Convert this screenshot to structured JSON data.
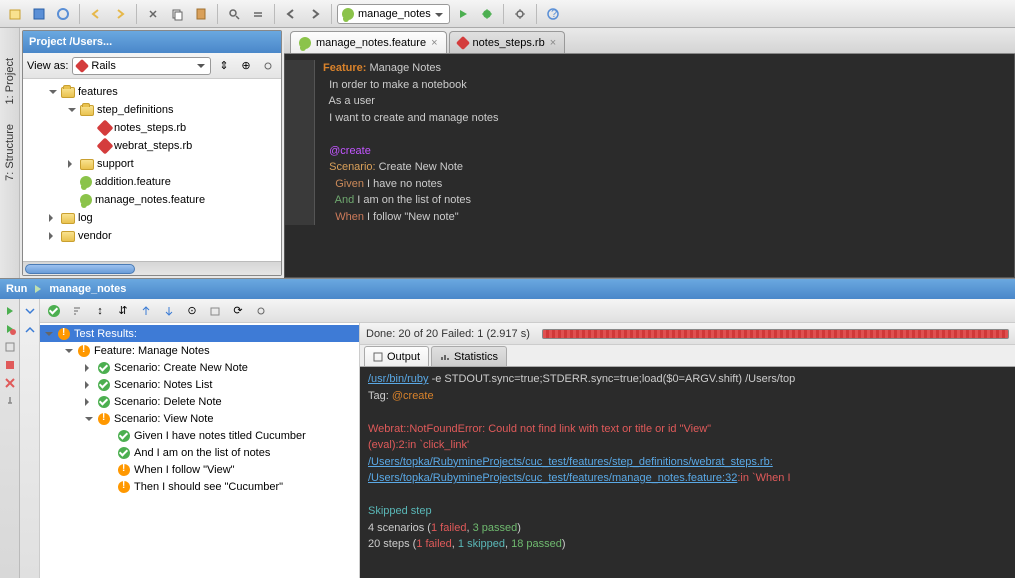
{
  "toolbar": {
    "run_config_label": "manage_notes"
  },
  "sidebar_rail": {
    "project": "1: Project",
    "structure": "7: Structure"
  },
  "project": {
    "title": "Project /Users...",
    "view_as_label": "View as:",
    "view_as_value": "Rails",
    "tree": {
      "features": "features",
      "step_definitions": "step_definitions",
      "notes_steps": "notes_steps.rb",
      "webrat_steps": "webrat_steps.rb",
      "support": "support",
      "addition_feature": "addition.feature",
      "manage_notes_feature": "manage_notes.feature",
      "log": "log",
      "vendor": "vendor"
    }
  },
  "editor": {
    "tabs": {
      "feature": "manage_notes.feature",
      "steps": "notes_steps.rb"
    },
    "code": {
      "l1a": "Feature:",
      "l1b": " Manage Notes",
      "l2": "  In order to make a notebook",
      "l3": "  As a user",
      "l4": "  I want to create and manage notes",
      "l6": "  @create",
      "l7a": "  Scenario:",
      "l7b": " Create New Note",
      "l8a": "    Given",
      "l8b": " I have no notes",
      "l9a": "    And",
      "l9b": " I am on the list of notes",
      "l10a": "    When",
      "l10b": " I follow \"New note\""
    }
  },
  "run": {
    "header_prefix": "Run",
    "header_name": "manage_notes",
    "done_text": "Done: 20 of 20  Failed: 1  (2.917 s)",
    "output_tab": "Output",
    "stats_tab": "Statistics",
    "tree": {
      "root": "Test Results:",
      "feature": "Feature: Manage Notes",
      "sc_create": "Scenario: Create New Note",
      "sc_list": "Scenario: Notes List",
      "sc_delete": "Scenario: Delete Note",
      "sc_view": "Scenario: View Note",
      "given": "Given I have notes titled Cucumber",
      "and": "And I am on the list of notes",
      "when": "When I follow \"View\"",
      "then": "Then I should see \"Cucumber\""
    },
    "console": {
      "l1a": "/usr/bin/ruby",
      "l1b": " -e STDOUT.sync=true;STDERR.sync=true;load($0=ARGV.shift) /Users/top",
      "l2a": "Tag: ",
      "l2b": "@create",
      "l4": "Webrat::NotFoundError: Could not find link with text or title or id \"View\"",
      "l5": "(eval):2:in `click_link'",
      "l6": "/Users/topka/RubymineProjects/cuc_test/features/step_definitions/webrat_steps.rb:",
      "l7a": "/Users/topka/RubymineProjects/cuc_test/features/manage_notes.feature:32",
      "l7b": ":in `When I",
      "l9": "Skipped step",
      "l10a": "4 scenarios (",
      "l10b": "1 failed",
      "l10c": ", ",
      "l10d": "3 passed",
      "l10e": ")",
      "l11a": "20 steps (",
      "l11b": "1 failed",
      "l11c": ", ",
      "l11d": "1 skipped",
      "l11e": ", ",
      "l11f": "18 passed",
      "l11g": ")"
    }
  }
}
